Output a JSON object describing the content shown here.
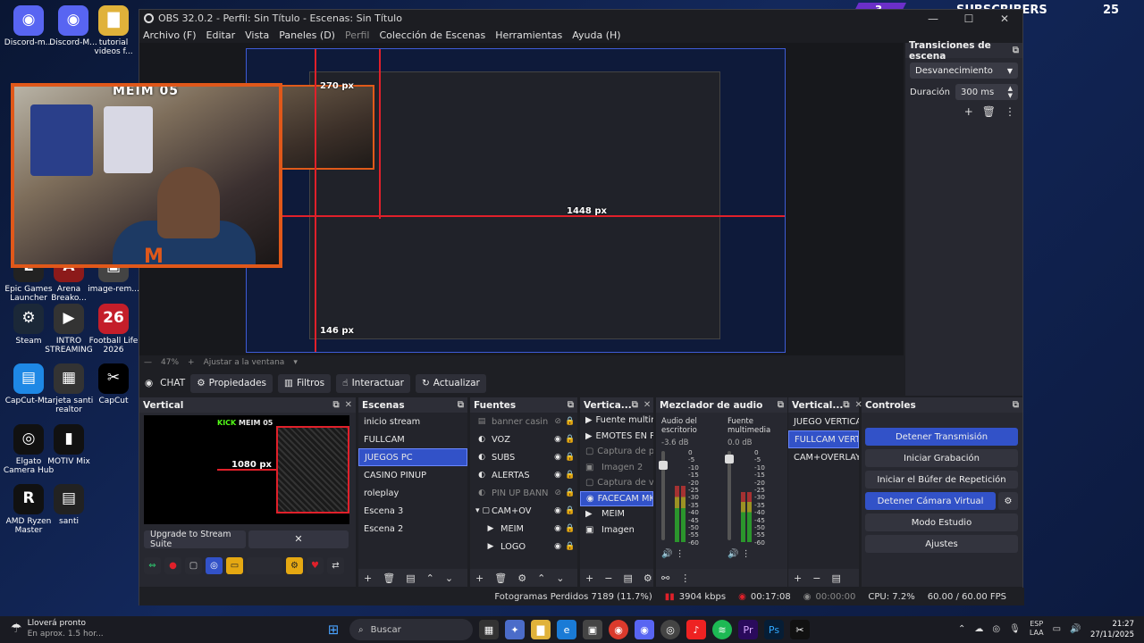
{
  "overlay": {
    "badge": "3",
    "label": "SUBSCRIBERS",
    "count": "25"
  },
  "desktop_icons": [
    {
      "label": "Discord-m...",
      "color": "#5865f2",
      "glyph": "◉"
    },
    {
      "label": "Discord-M...",
      "color": "#5865f2",
      "glyph": "◉"
    },
    {
      "label": "tutorial videos f...",
      "color": "#e0b23a",
      "glyph": "▇"
    },
    {
      "label": "Epic Games Launcher",
      "color": "#222",
      "glyph": "E"
    },
    {
      "label": "Arena Breako...",
      "color": "#8c1a1a",
      "glyph": "A"
    },
    {
      "label": "image-rem...",
      "color": "#444",
      "glyph": "▣"
    },
    {
      "label": "Steam",
      "color": "#1b2838",
      "glyph": "⚙"
    },
    {
      "label": "INTRO STREAMING",
      "color": "#333",
      "glyph": "▶"
    },
    {
      "label": "Football Life 2026",
      "color": "#c41e2a",
      "glyph": "26"
    },
    {
      "label": "CapCut-M...",
      "color": "#1e88e5",
      "glyph": "▤"
    },
    {
      "label": "tarjeta santi realtor",
      "color": "#333",
      "glyph": "▦"
    },
    {
      "label": "CapCut",
      "color": "#000",
      "glyph": "✂"
    },
    {
      "label": "Elgato Camera Hub",
      "color": "#111",
      "glyph": "◎"
    },
    {
      "label": "MOTIV Mix",
      "color": "#111",
      "glyph": "▮"
    },
    {
      "label": "AMD Ryzen Master",
      "color": "#111",
      "glyph": "R"
    },
    {
      "label": "santi",
      "color": "#222",
      "glyph": "▤"
    }
  ],
  "webcam": {
    "nametag": "MEIM 05",
    "logo": "M"
  },
  "window": {
    "title": "OBS 32.0.2 - Perfil: Sin Título - Escenas: Sin Título",
    "controls": [
      "—",
      "☐",
      "✕"
    ]
  },
  "menu": [
    "Archivo (F)",
    "Editar",
    "Vista",
    "Paneles (D)",
    "Perfil",
    "Colección de Escenas",
    "Herramientas",
    "Ayuda (H)"
  ],
  "preview": {
    "label_top": "270 px",
    "label_right": "1448 px",
    "label_bottom": "146 px"
  },
  "zoom": {
    "percent": "47%",
    "minus": "—",
    "plus": "+",
    "fit": "Ajustar a la ventana",
    "chev": "▾"
  },
  "context": {
    "source": "CHAT",
    "buttons": [
      "Propiedades",
      "Filtros",
      "Interactuar",
      "Actualizar"
    ]
  },
  "transitions": {
    "title": "Transiciones de escena",
    "selected": "Desvanecimiento",
    "duration_label": "Duración",
    "duration_value": "300 ms"
  },
  "vertical": {
    "title": "Vertical",
    "kick": "KICK",
    "name": "MEIM 05",
    "px": "1080 px",
    "upgrade": "Upgrade to Stream Suite",
    "close": "✕"
  },
  "scenes": {
    "title": "Escenas",
    "items": [
      "inicio stream",
      "FULLCAM",
      "JUEGOS PC",
      "CASINO PINUP",
      "roleplay",
      "Escena 3",
      "Escena 2"
    ],
    "selected_index": 2
  },
  "sources": {
    "title": "Fuentes",
    "items": [
      {
        "label": "banner casin",
        "icon": "▤",
        "visible": false
      },
      {
        "label": "VOZ",
        "icon": "◐",
        "visible": true
      },
      {
        "label": "SUBS",
        "icon": "◐",
        "visible": true
      },
      {
        "label": "ALERTAS",
        "icon": "◐",
        "visible": true
      },
      {
        "label": "PIN UP BANN",
        "icon": "◐",
        "visible": false
      },
      {
        "label": "CAM+OV",
        "icon": "▾ ▢",
        "visible": true
      },
      {
        "label": "MEIM",
        "icon": "▶",
        "visible": true
      },
      {
        "label": "LOGO",
        "icon": "▶",
        "visible": true
      }
    ]
  },
  "vertical_scenes": {
    "title": "Vertica...",
    "items": [
      {
        "label": "Fuente multir",
        "icon": "▶",
        "dim": false
      },
      {
        "label": "EMOTES EN P",
        "icon": "▶",
        "dim": false
      },
      {
        "label": "Captura de pa",
        "icon": "▢",
        "dim": true
      },
      {
        "label": "Imagen 2",
        "icon": "▣",
        "dim": true
      },
      {
        "label": "Captura de ve",
        "icon": "▢",
        "dim": true
      },
      {
        "label": "FACECAM MK",
        "icon": "◉",
        "dim": false
      },
      {
        "label": "MEIM",
        "icon": "▶",
        "dim": false
      },
      {
        "label": "Imagen",
        "icon": "▣",
        "dim": false
      }
    ],
    "selected_index": 5
  },
  "mixer": {
    "title": "Mezclador de audio",
    "channels": [
      {
        "name": "Audio del escritorio",
        "db": "-3.6 dB",
        "level": 0.62,
        "fader": 0.88
      },
      {
        "name": "Fuente multimedia",
        "db": "0.0 dB",
        "level": 0.55,
        "fader": 0.96
      }
    ],
    "scale": [
      "0",
      "-5",
      "-10",
      "-15",
      "-20",
      "-25",
      "-30",
      "-35",
      "-40",
      "-45",
      "-50",
      "-55",
      "-60"
    ]
  },
  "vertical_scenes2": {
    "title": "Vertical...",
    "items": [
      "JUEGO VERTICAL L",
      "FULLCAM VERTICA",
      "CAM+OVERLAY"
    ],
    "selected_index": 1
  },
  "controls": {
    "title": "Controles",
    "buttons": [
      {
        "label": "Detener Transmisión",
        "active": true
      },
      {
        "label": "Iniciar Grabación",
        "active": false
      },
      {
        "label": "Iniciar el Búfer de Repetición",
        "active": false
      },
      {
        "label": "Detener Cámara Virtual",
        "active": true
      },
      {
        "label": "Modo Estudio",
        "active": false
      },
      {
        "label": "Ajustes",
        "active": false
      }
    ]
  },
  "status": {
    "dropped": "Fotogramas Perdidos 7189 (11.7%)",
    "kbps": "3904 kbps",
    "stream_time": "00:17:08",
    "rec_time": "00:00:00",
    "cpu": "CPU: 7.2%",
    "fps": "60.00 / 60.00 FPS"
  },
  "taskbar": {
    "weather_title": "Lloverá pronto",
    "weather_sub": "En aprox. 1.5 hor...",
    "search": "Buscar",
    "lang_top": "ESP",
    "lang_bottom": "LAA",
    "time": "21:27",
    "date": "27/11/2025"
  },
  "colors": {
    "accent": "#3252c8",
    "orange": "#e0581a",
    "red": "#e0202a"
  }
}
